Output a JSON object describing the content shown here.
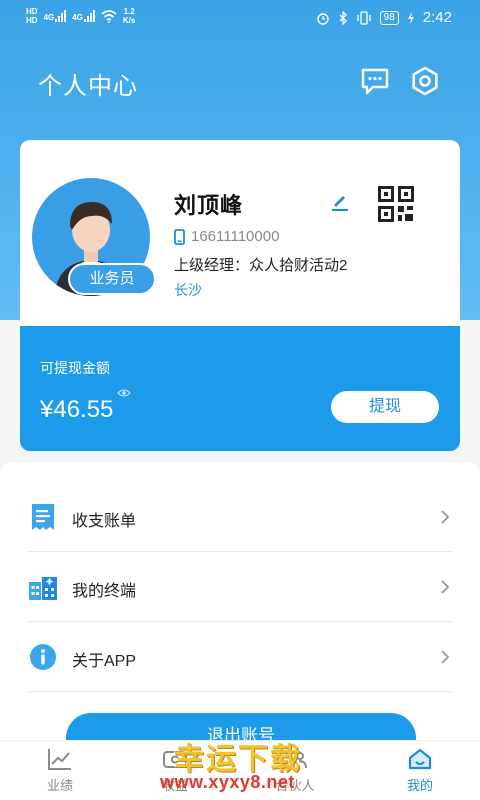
{
  "status_bar": {
    "hd1": "HD",
    "hd2": "HD",
    "sig1": "4G",
    "sig2": "4G",
    "speed_value": "1.2",
    "speed_unit": "K/s",
    "battery": "98",
    "time": "2:42"
  },
  "header": {
    "title": "个人中心",
    "icons": [
      "message-icon",
      "settings-icon"
    ]
  },
  "profile": {
    "name": "刘顶峰",
    "role": "业务员",
    "phone": "16611110000",
    "superior": "上级经理：众人拾财活动2",
    "city": "长沙"
  },
  "balance": {
    "label": "可提现金额",
    "amount": "¥46.55",
    "withdraw_label": "提现"
  },
  "menu": {
    "items": [
      {
        "label": "收支账单",
        "icon": "bill-icon"
      },
      {
        "label": "我的终端",
        "icon": "terminal-icon"
      },
      {
        "label": "关于APP",
        "icon": "info-icon"
      }
    ]
  },
  "logout": {
    "label": "退出账号"
  },
  "tabs": [
    {
      "label": "业绩",
      "icon": "chart-icon"
    },
    {
      "label": "收益",
      "icon": "earnings-icon"
    },
    {
      "label": "合伙人",
      "icon": "partners-icon"
    },
    {
      "label": "我的",
      "icon": "home-icon",
      "active": true
    }
  ],
  "watermark": {
    "title": "幸运下载",
    "url": "www.xyxy8.net"
  },
  "colors": {
    "primary": "#1d9bea",
    "header_gradient_top": "#3aa3e6",
    "accent_text": "#1d8be0"
  }
}
